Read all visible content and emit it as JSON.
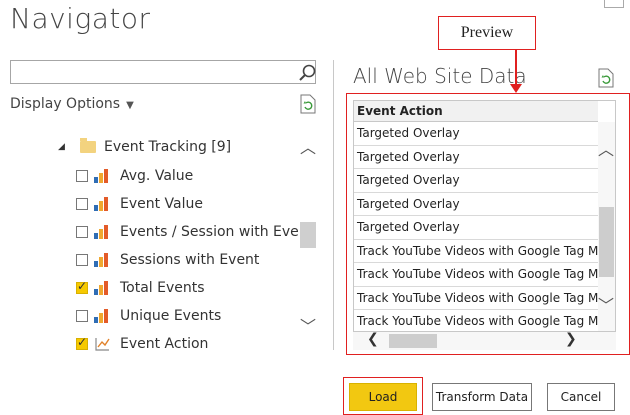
{
  "window": {
    "title": "Navigator"
  },
  "left_panel": {
    "search": {
      "value": "",
      "placeholder": ""
    },
    "display_options_label": "Display Options",
    "tree": {
      "folder": {
        "label": "Event Tracking [9]",
        "expanded": true
      },
      "items": [
        {
          "label": "Avg. Value",
          "checked": false,
          "icon": "measure-bars-icon"
        },
        {
          "label": "Event Value",
          "checked": false,
          "icon": "measure-bars-icon"
        },
        {
          "label": "Events / Session with Event",
          "checked": false,
          "icon": "measure-bars-icon"
        },
        {
          "label": "Sessions with Event",
          "checked": false,
          "icon": "measure-bars-icon"
        },
        {
          "label": "Total Events",
          "checked": true,
          "icon": "measure-bars-icon"
        },
        {
          "label": "Unique Events",
          "checked": false,
          "icon": "measure-bars-icon"
        },
        {
          "label": "Event Action",
          "checked": true,
          "icon": "dimension-icon"
        }
      ]
    }
  },
  "preview": {
    "title": "All Web Site Data",
    "annotation_label": "Preview",
    "column_header": "Event Action",
    "rows": [
      "Targeted Overlay",
      "Targeted Overlay",
      "Targeted Overlay",
      "Targeted Overlay",
      "Targeted Overlay",
      "Track YouTube Videos with Google Tag Man",
      "Track YouTube Videos with Google Tag Man",
      "Track YouTube Videos with Google Tag Man",
      "Track YouTube Videos with Google Tag Man"
    ]
  },
  "buttons": {
    "load": "Load",
    "transform": "Transform Data",
    "cancel": "Cancel"
  },
  "colors": {
    "accent": "#f2c811",
    "annotation": "#e02020"
  }
}
